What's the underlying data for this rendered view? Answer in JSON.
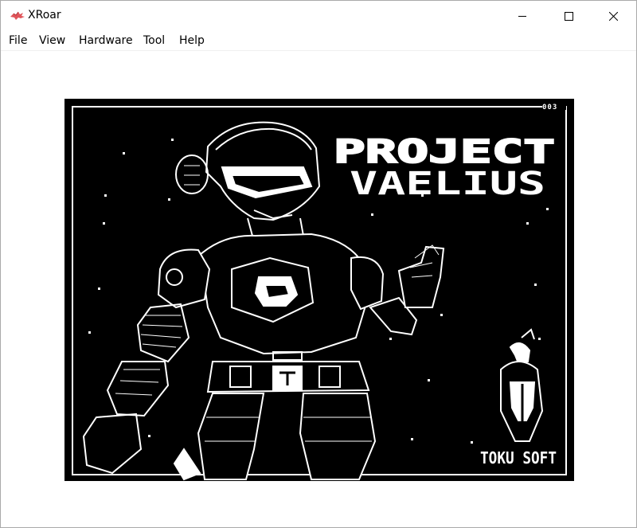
{
  "window": {
    "title": "XRoar",
    "app_icon": "xroar-dragon-icon",
    "controls": {
      "minimize_icon": "minimize-icon",
      "maximize_icon": "maximize-icon",
      "close_icon": "close-icon"
    }
  },
  "menu": {
    "items": [
      {
        "label": "File"
      },
      {
        "label": "View"
      },
      {
        "label": "Hardware"
      },
      {
        "label": "Tool"
      },
      {
        "label": "Help"
      }
    ]
  },
  "screen": {
    "background": "#000000",
    "foreground": "#ffffff",
    "counter": "003",
    "title_line1": "PROJECT",
    "title_line2": "VAELIUS",
    "publisher": "TOKU SOFT",
    "publisher_logo": "spartan-helmet-logo"
  }
}
